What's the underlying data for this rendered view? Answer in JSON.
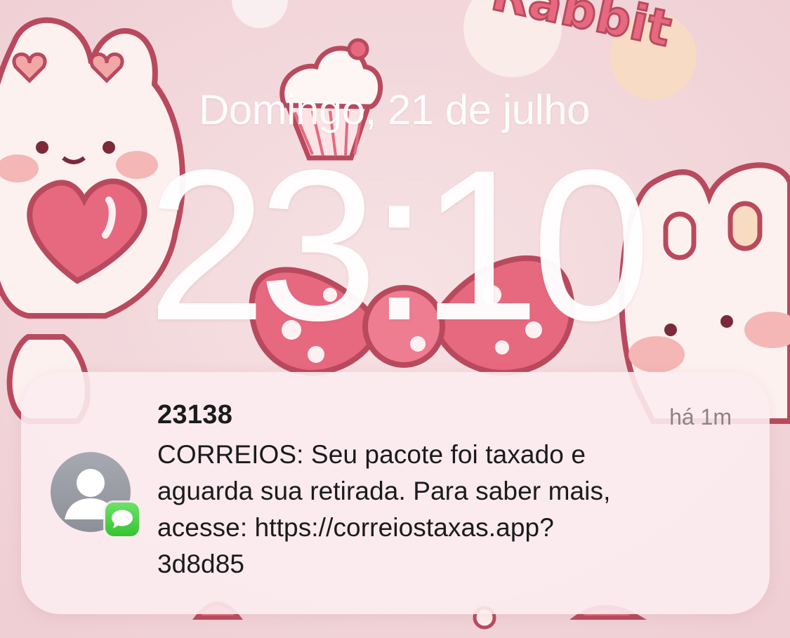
{
  "lock_screen": {
    "date": "Domingo, 21 de julho",
    "time": "23:10"
  },
  "wallpaper": {
    "text": "Rabbit",
    "colors": {
      "background": "#f3d9dd",
      "pink": "#e6697f",
      "outline": "#b94a5e",
      "cream": "#fdf1f0"
    }
  },
  "notification": {
    "sender": "23138",
    "timestamp": "há 1m",
    "message_lines": [
      "CORREIOS: Seu pacote foi taxado e",
      "aguarda sua retirada. Para saber mais,",
      "acesse: https://correiostaxas.app?",
      "3d8d85"
    ],
    "avatar_icon": "person-silhouette-icon",
    "app_icon": "messages-icon",
    "colors": {
      "card": "#fcecf0",
      "badge_green": "#34c431",
      "avatar_gray": "#9a9ca5"
    }
  }
}
